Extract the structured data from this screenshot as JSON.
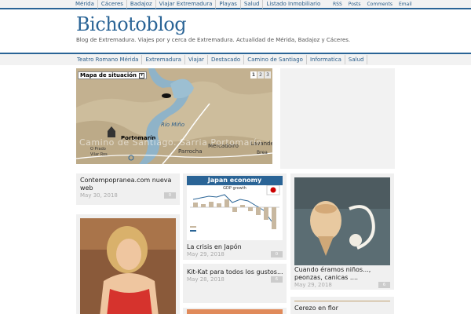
{
  "top_nav": {
    "links": [
      "Mérida",
      "Cáceres",
      "Badajoz",
      "Viajar Extremadura",
      "Playas",
      "Salud",
      "Listado Inmobiliario"
    ],
    "right_links": [
      "RSS",
      "Posts",
      "Comments",
      "Email"
    ]
  },
  "site": {
    "title": "Bichotoblog",
    "tagline": "Blog de Extremadura. Viajes por y cerca de Extremadura. Actualidad de Mérida, Badajoz y Cáceres."
  },
  "main_nav": {
    "items": [
      "Teatro Romano Mérida",
      "Extremadura",
      "Viajar",
      "Destacado",
      "Camino de Santiago",
      "Informatica",
      "Salud"
    ]
  },
  "slider": {
    "select_label": "Mapa de situación",
    "pages": [
      "1",
      "2",
      "3"
    ],
    "active_page": "1",
    "map_labels": {
      "river": "Río Miño",
      "town1": "Portomarín",
      "town2": "Parrocha",
      "town3": "Mercadoiro",
      "town4": "Lavandeira",
      "town5": "Brea",
      "small": "O Prado",
      "small2": "Vilar Ros"
    },
    "overlay_text": "Camino de Santiago. Sarria Portomarín"
  },
  "posts": [
    {
      "title": "Contempopranea.com nueva web",
      "date": "May 30, 2018",
      "comments": "0"
    },
    {
      "title": "La crisis en Japón",
      "date": "May 29, 2018",
      "comments": "0"
    },
    {
      "title": "Kit-Kat para todos los gustos...",
      "date": "May 28, 2018",
      "comments": "6"
    },
    {
      "title": "Cuando éramos niños..., peonzas, canicas ....",
      "date": "May 29, 2018",
      "comments": "6"
    },
    {
      "title": "Cerezo en flor",
      "date": "",
      "comments": ""
    }
  ],
  "japan_chart": {
    "title": "Japan economy",
    "subtitle": "GDP growth"
  }
}
